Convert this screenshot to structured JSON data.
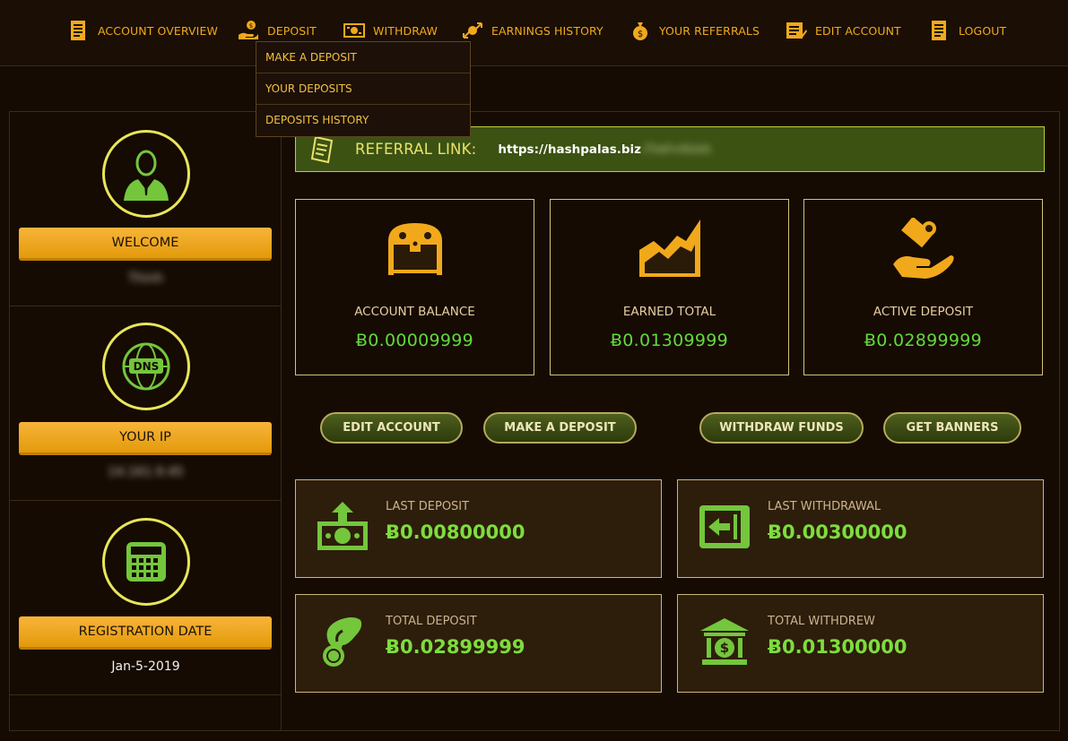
{
  "nav": {
    "items": [
      {
        "label": "ACCOUNT OVERVIEW",
        "icon": "ledger-icon"
      },
      {
        "label": "DEPOSIT",
        "icon": "hand-coin-icon"
      },
      {
        "label": "WITHDRAW",
        "icon": "cash-icon"
      },
      {
        "label": "EARNINGS HISTORY",
        "icon": "coin-arrows-icon"
      },
      {
        "label": "YOUR REFERRALS",
        "icon": "money-bag-icon"
      },
      {
        "label": "EDIT ACCOUNT",
        "icon": "edit-document-icon"
      },
      {
        "label": "LOGOUT",
        "icon": "door-document-icon"
      }
    ]
  },
  "dropdown": {
    "items": [
      "MAKE A DEPOSIT",
      "YOUR DEPOSITS",
      "DEPOSITS HISTORY"
    ]
  },
  "sidebar": {
    "welcome_label": "WELCOME",
    "welcome_value": "Thinh",
    "ip_label": "YOUR IP",
    "ip_value": "14.161.9.45",
    "dns_text": "DNS",
    "reg_label": "REGISTRATION DATE",
    "reg_value": "Jan-5-2019"
  },
  "referral": {
    "label": "REFERRAL LINK:",
    "url": "https://hashpalas.biz",
    "url_hidden": "/?ref=thinh"
  },
  "stats": [
    {
      "label": "ACCOUNT BALANCE",
      "value": "Ƀ0.00009999",
      "icon": "treasure-chest-icon"
    },
    {
      "label": "EARNED TOTAL",
      "value": "Ƀ0.01309999",
      "icon": "growth-chart-icon"
    },
    {
      "label": "ACTIVE DEPOSIT",
      "value": "Ƀ0.02899999",
      "icon": "hand-money-icon"
    }
  ],
  "actions": [
    "EDIT ACCOUNT",
    "MAKE A DEPOSIT",
    "WITHDRAW FUNDS",
    "GET BANNERS"
  ],
  "summary": [
    {
      "label": "LAST DEPOSIT",
      "value": "Ƀ0.00800000",
      "icon": "cash-upload-icon"
    },
    {
      "label": "LAST WITHDRAWAL",
      "value": "Ƀ0.00300000",
      "icon": "atm-withdraw-icon"
    },
    {
      "label": "TOTAL DEPOSIT",
      "value": "Ƀ0.02899999",
      "icon": "hand-coin-icon"
    },
    {
      "label": "TOTAL WITHDREW",
      "value": "Ƀ0.01300000",
      "icon": "bank-icon"
    }
  ],
  "colors": {
    "accent": "#f1a91b",
    "value_green": "#62d93c",
    "circle_yellow": "#e8e65a",
    "referral_bg": "#3c5213"
  }
}
